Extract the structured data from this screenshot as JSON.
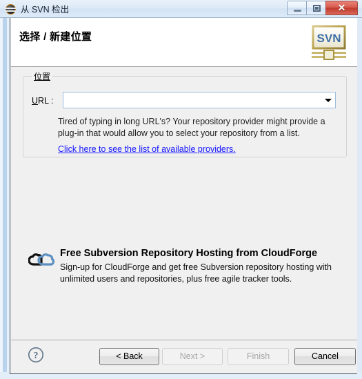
{
  "window": {
    "title": "从 SVN 检出",
    "icon": "svn-repository-icon",
    "controls": {
      "minimize": "minimize-button",
      "restore": "restore-button",
      "close_glyph": "✕"
    }
  },
  "header": {
    "title": "选择 / 新建位置",
    "logo_text": "SVN"
  },
  "location_group": {
    "legend": "位置",
    "url_label_mnemonic": "U",
    "url_label_rest": "RL :",
    "url_value": "",
    "url_placeholder": "",
    "hint": "Tired of typing in long URL's?  Your repository provider might provide a plug-in that would allow you to select your repository from a list.",
    "link": "Click here to see the list of available providers."
  },
  "cloudforge": {
    "title": "Free Subversion Repository Hosting from CloudForge",
    "description": "Sign-up for CloudForge and get free Subversion repository hosting with unlimited users and repositories, plus free agile tracker tools.",
    "icon": "cloudforge-cloud-icon"
  },
  "buttons": {
    "help": "?",
    "back": "< Back",
    "back_mnemonic": "B",
    "next": "Next >",
    "next_mnemonic": "N",
    "finish": "Finish",
    "finish_mnemonic": "F",
    "cancel": "Cancel",
    "states": {
      "back": "enabled",
      "next": "disabled",
      "finish": "disabled",
      "cancel": "enabled"
    }
  },
  "colors": {
    "link": "#1414ff",
    "header_bg": "#ffffff",
    "body_bg": "#f0f0f0",
    "close_button": "#bf3a2c",
    "svn_logo_text": "#3f6fa8",
    "cloud_blue": "#5b8fc0"
  }
}
